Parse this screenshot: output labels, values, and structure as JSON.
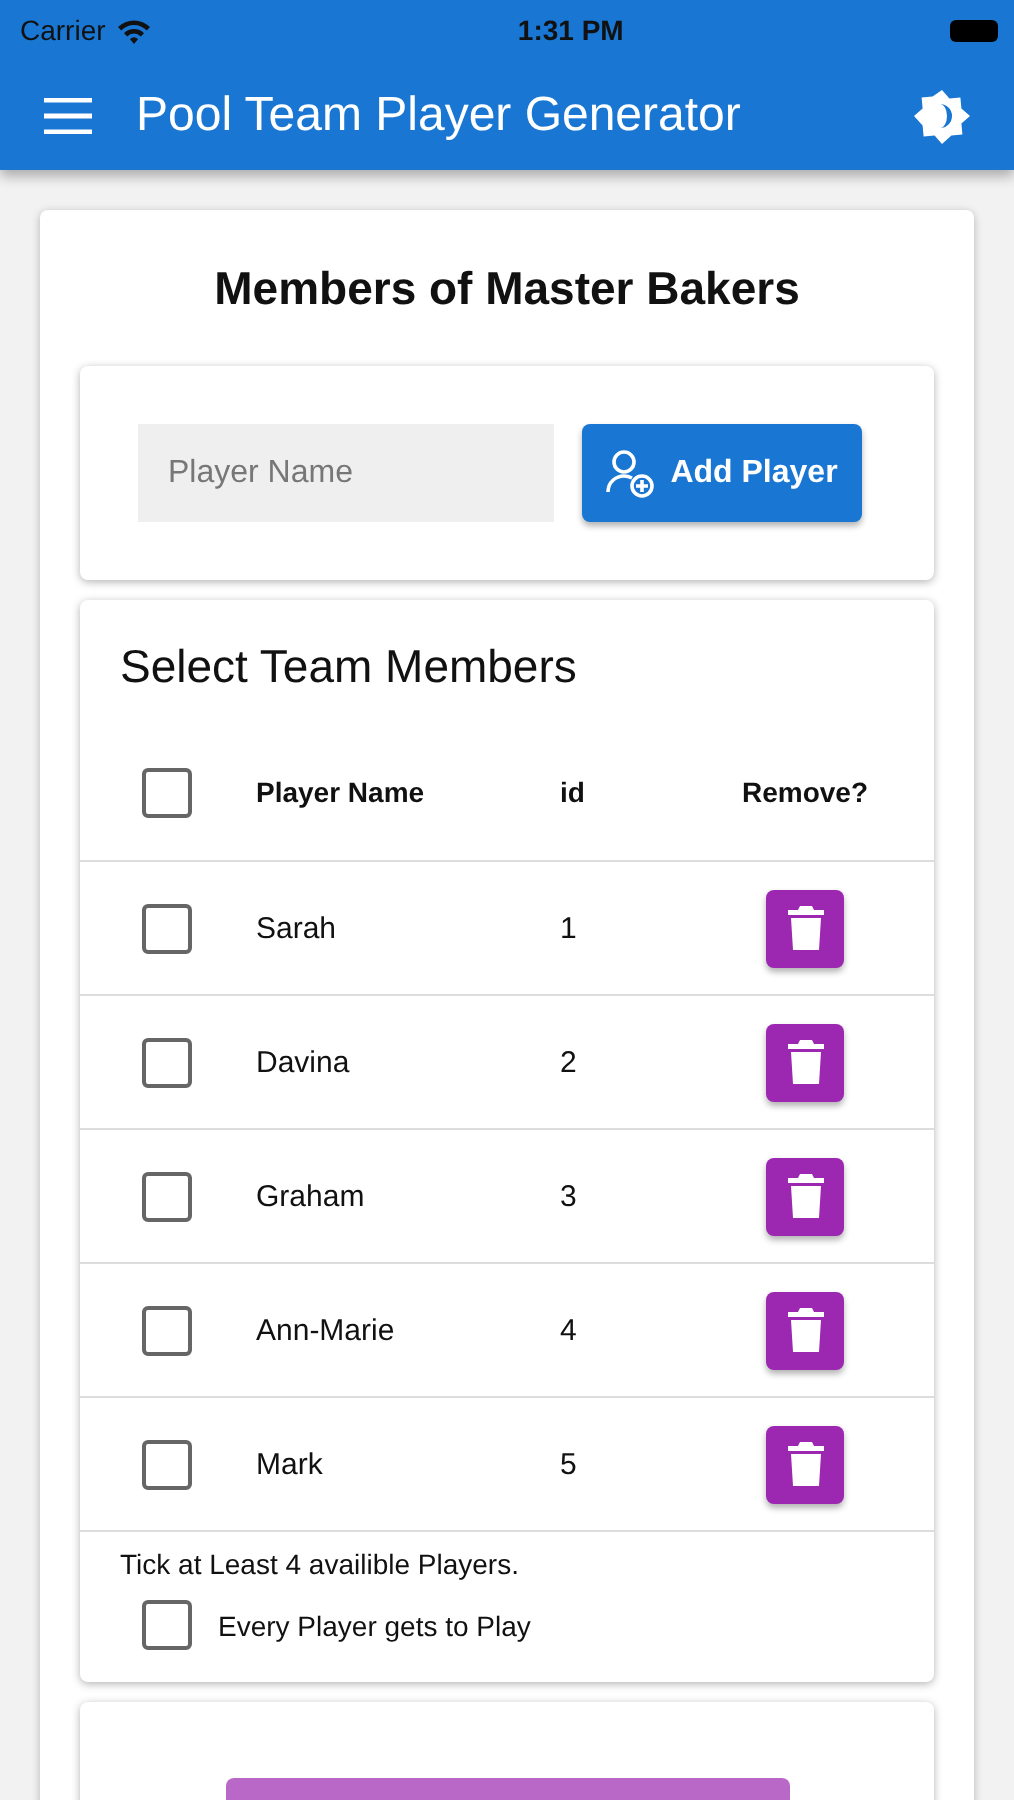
{
  "status_bar": {
    "carrier": "Carrier",
    "time": "1:31 PM"
  },
  "app_bar": {
    "title": "Pool Team Player Generator"
  },
  "team_title": "Members of Master Bakers",
  "add_player": {
    "placeholder": "Player Name",
    "button": "Add Player"
  },
  "members": {
    "heading": "Select Team Members",
    "all_checked": false,
    "columns": [
      "Player Name",
      "id",
      "Remove?"
    ],
    "rows": [
      {
        "name": "Sarah",
        "id": "1",
        "checked": false
      },
      {
        "name": "Davina",
        "id": "2",
        "checked": false
      },
      {
        "name": "Graham",
        "id": "3",
        "checked": false
      },
      {
        "name": "Ann-Marie",
        "id": "4",
        "checked": false
      },
      {
        "name": "Mark",
        "id": "5",
        "checked": false
      }
    ],
    "hint": "Tick at Least 4 availible Players.",
    "option": {
      "label": "Every Player gets to Play",
      "checked": false
    }
  }
}
